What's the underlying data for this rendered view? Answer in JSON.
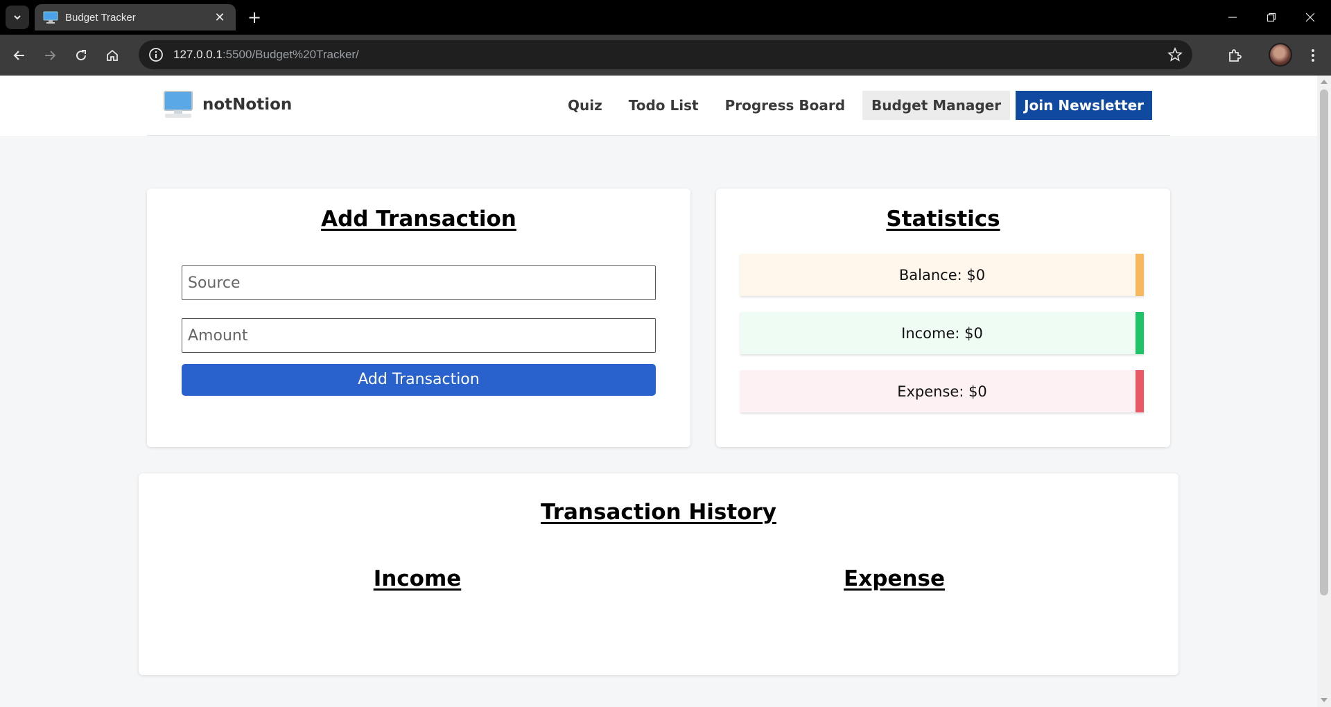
{
  "browser": {
    "tab_title": "Budget Tracker",
    "url_host": "127.0.0.1",
    "url_path": ":5500/Budget%20Tracker/"
  },
  "header": {
    "brand": "notNotion",
    "nav": {
      "quiz": "Quiz",
      "todo": "Todo List",
      "progress": "Progress Board",
      "budget": "Budget Manager",
      "newsletter": "Join Newsletter"
    }
  },
  "add_transaction": {
    "title": "Add Transaction",
    "source_placeholder": "Source",
    "amount_placeholder": "Amount",
    "button_label": "Add Transaction"
  },
  "statistics": {
    "title": "Statistics",
    "balance": "Balance: $0",
    "income": "Income: $0",
    "expense": "Expense: $0"
  },
  "history": {
    "title": "Transaction History",
    "income_heading": "Income",
    "expense_heading": "Expense"
  },
  "colors": {
    "accent": "#2962cc",
    "newsletter": "#0f4aa0",
    "balance_bar": "#f6b95e",
    "income_bar": "#1fc46a",
    "expense_bar": "#e85866",
    "balance_bg": "#fff6ec",
    "income_bg": "#eefcf3",
    "expense_bg": "#fdf1f3"
  }
}
